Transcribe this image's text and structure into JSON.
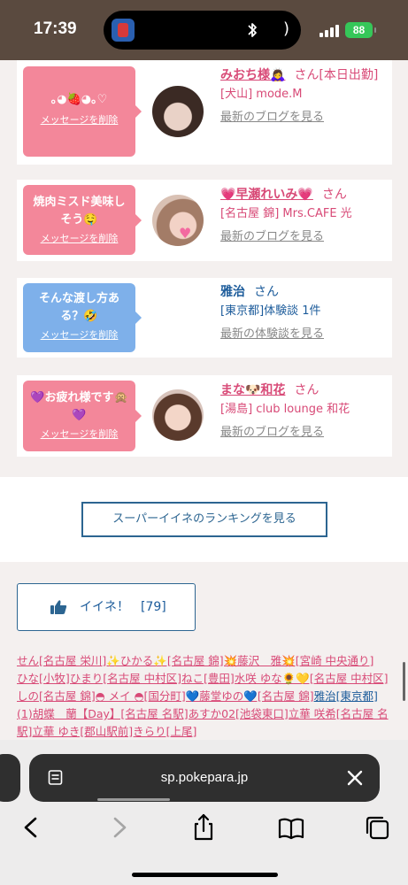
{
  "status_bar": {
    "time": "17:39",
    "battery": "88"
  },
  "cards": [
    {
      "message": "｡⁠◕⁠🍓⁠◕｡♡",
      "delete_label": "メッセージを削除",
      "name": "みおち様🙇‍♀️",
      "suffix": "さん[本日出勤]",
      "shop": "[犬山] mode.M",
      "link": "最新のブログを見る",
      "bubble_color": "#f3879a"
    },
    {
      "message": "焼肉ミスド美味しそう🤤",
      "delete_label": "メッセージを削除",
      "name": "💗早瀬れいみ💗",
      "suffix": "さん",
      "shop": "[名古屋 錦] Mrs.CAFE 光",
      "link": "最新のブログを見る",
      "bubble_color": "#f3879a"
    },
    {
      "message": "そんな渡し方ある？🤣",
      "delete_label": "メッセージを削除",
      "name": "雅治",
      "suffix": "さん",
      "shop": "[東京都]体験談 1件",
      "link": "最新の体験談を見る",
      "bubble_color": "#7eb0ea"
    },
    {
      "message": "💜お疲れ様です🙊💜",
      "delete_label": "メッセージを削除",
      "name": "まな🐶和花",
      "suffix": "さん",
      "shop": "[湯島] club lounge 和花",
      "link": "最新のブログを見る",
      "bubble_color": "#f3879a"
    }
  ],
  "ranking_button": "スーパーイイネのランキングを見る",
  "iine": {
    "label": "イイネ！",
    "count": "[79]"
  },
  "names_lines": [
    "せん[名古屋 栄川]✨ひかる✨[名古屋 錦]💥藤沢　雅💥[宮崎 中央通り]",
    "ひな[小牧]ひまり[名古屋 中村区]ねこ[豊田]水咲 ゆな🌻💛[名古屋 中村区]",
    "しの[名古屋 錦]◓ メイ ◓[国分町]💙藤堂ゆの💙[名古屋 錦]",
    "(1)胡蝶　蘭【Day】[名古屋 名駅]あすか02[池袋東口]立華 咲希[名古屋 名",
    "駅]立華 ゆき[郡山駅前]きらり[上尾]"
  ],
  "names_blue": {
    "name": "雅治",
    "place": "[東京都]"
  },
  "browser": {
    "url": "sp.pokepara.jp"
  },
  "icons": {
    "status": [
      "bluetooth-icon",
      "signal-icon",
      "battery-icon"
    ],
    "toolbar": [
      "back-icon",
      "forward-icon",
      "share-icon",
      "bookmarks-icon",
      "tabs-icon"
    ],
    "urlbar": [
      "reader-icon",
      "close-icon"
    ],
    "iine": "thumbs-up-icon"
  },
  "colors": {
    "pink": "#d84a77",
    "blue": "#1d5c9b",
    "status_bar": "#5a4a3f",
    "battery": "#35c759"
  }
}
